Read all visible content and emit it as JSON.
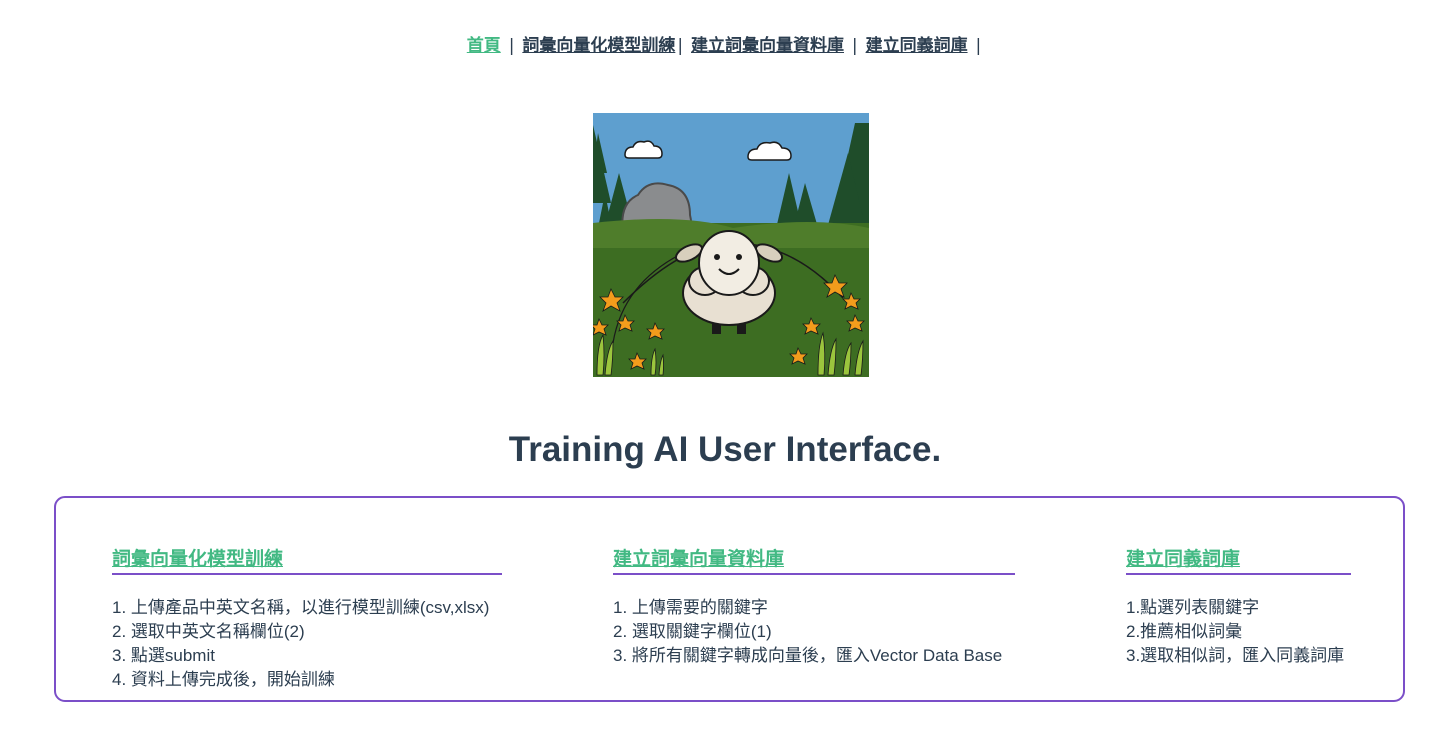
{
  "nav": {
    "items": [
      {
        "label": "首頁",
        "active": true
      },
      {
        "label": "詞彙向量化模型訓練",
        "active": false
      },
      {
        "label": "建立詞彙向量資料庫",
        "active": false
      },
      {
        "label": "建立同義詞庫",
        "active": false
      }
    ],
    "separator": "|"
  },
  "hero": {
    "icons": [
      "sheep-illustration",
      "cloud-icon",
      "tree-icon",
      "flower-icon",
      "rock-icon"
    ]
  },
  "page_title": "Training AI User Interface.",
  "sections": [
    {
      "heading": "詞彙向量化模型訓練",
      "steps": [
        "1. 上傳產品中英文名稱，以進行模型訓練(csv,xlsx)",
        "2. 選取中英文名稱欄位(2)",
        "3. 點選submit",
        "4. 資料上傳完成後，開始訓練"
      ]
    },
    {
      "heading": "建立詞彙向量資料庫",
      "steps": [
        "1. 上傳需要的關鍵字",
        "2. 選取關鍵字欄位(1)",
        "3. 將所有關鍵字轉成向量後，匯入Vector Data Base"
      ]
    },
    {
      "heading": "建立同義詞庫",
      "steps": [
        "1.點選列表關鍵字",
        "2.推薦相似詞彙",
        "3.選取相似詞，匯入同義詞庫"
      ]
    }
  ],
  "colors": {
    "accent_green": "#42b983",
    "text_dark": "#2c3e50",
    "panel_border": "#7b4fc8"
  }
}
